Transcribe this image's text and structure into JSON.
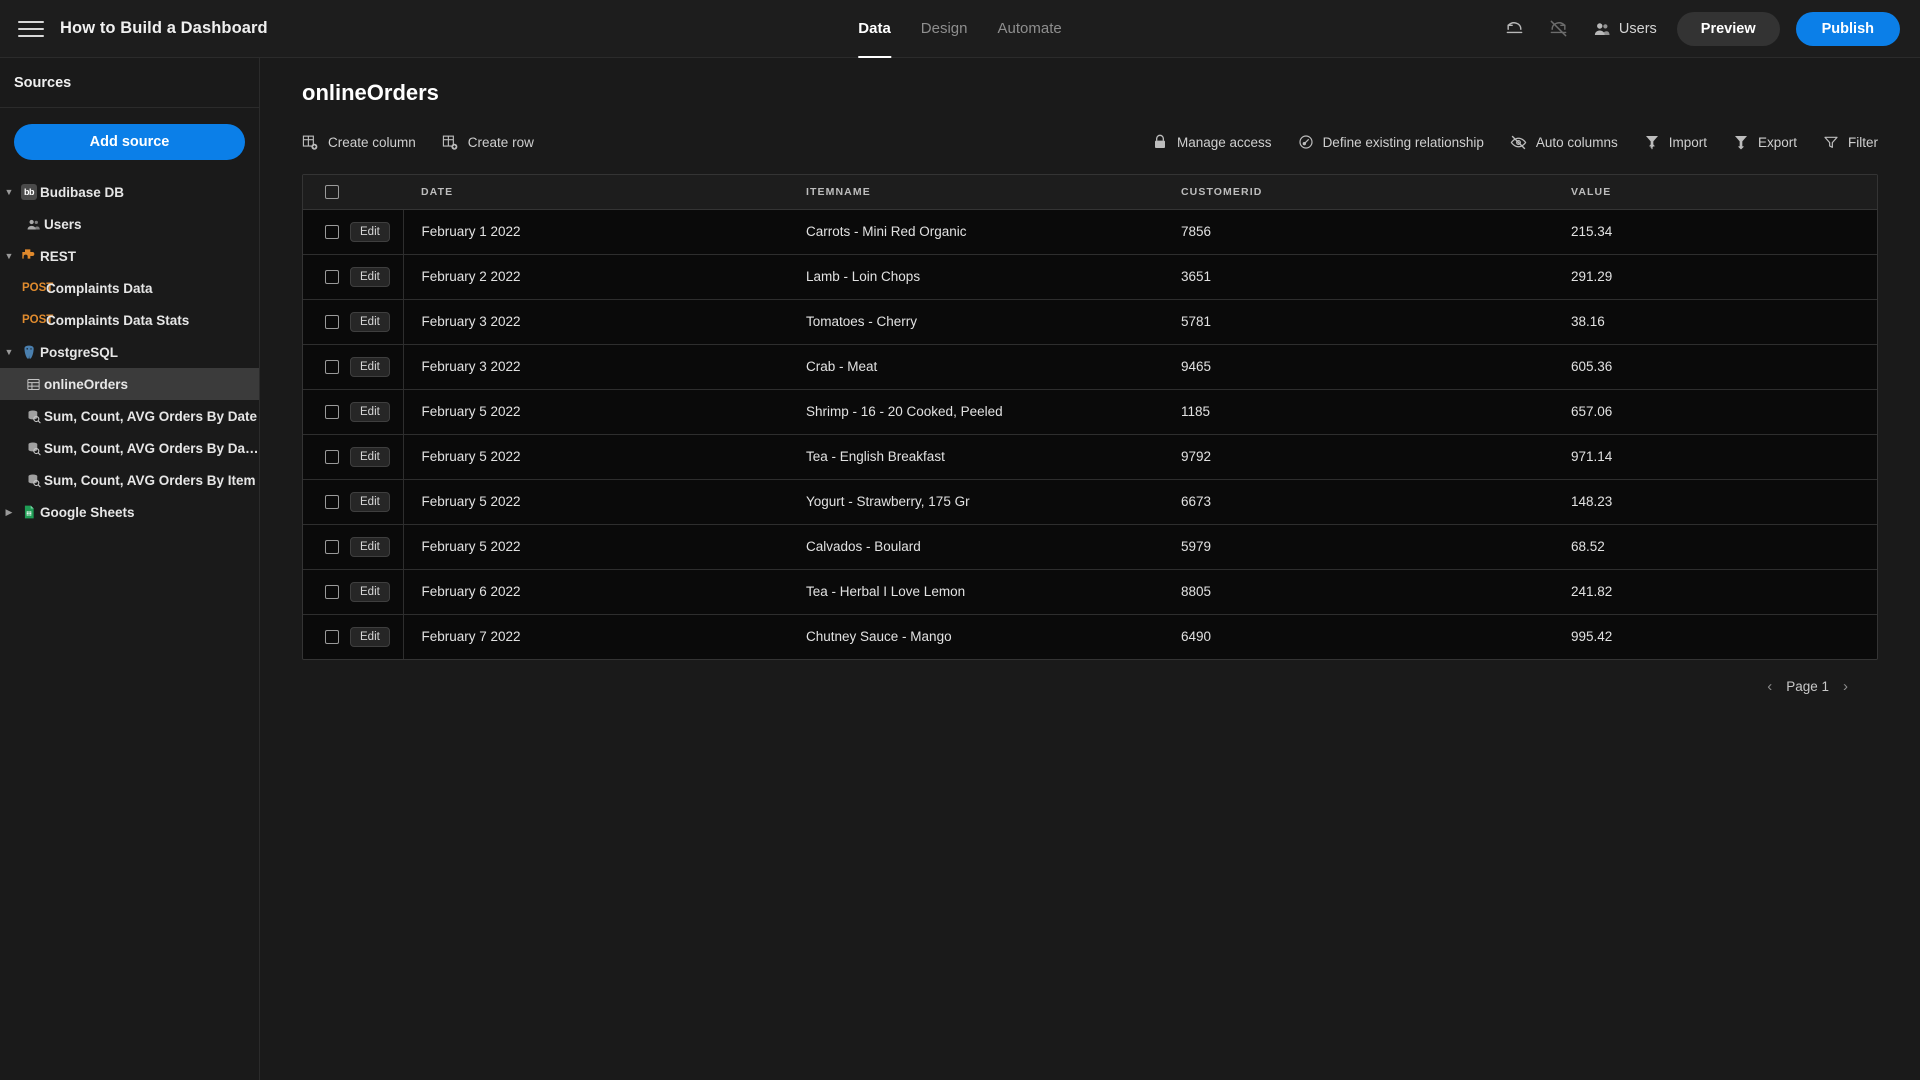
{
  "topbar": {
    "menu_icon": "hamburger-icon",
    "app_title": "How to Build a Dashboard",
    "tabs": [
      {
        "label": "Data",
        "active": true
      },
      {
        "label": "Design",
        "active": false
      },
      {
        "label": "Automate",
        "active": false
      }
    ],
    "undo_icon": "undo-icon",
    "redo_icon": "redo-disabled-icon",
    "users_icon": "users-icon",
    "users_label": "Users",
    "preview_label": "Preview",
    "publish_label": "Publish",
    "publish_color": "#0b7fe8"
  },
  "sidebar": {
    "header": "Sources",
    "add_source_label": "Add source",
    "tree": [
      {
        "level": 1,
        "icon": "budibase-db-icon",
        "label": "Budibase DB",
        "chevron": "down",
        "selected": false
      },
      {
        "level": 2,
        "icon": "users-icon",
        "label": "Users",
        "chevron": "",
        "selected": false
      },
      {
        "level": 1,
        "icon": "rest-icon",
        "label": "REST",
        "chevron": "down",
        "selected": false
      },
      {
        "level": 2,
        "icon": "",
        "method": "POST",
        "label": "Complaints Data",
        "chevron": "",
        "selected": false
      },
      {
        "level": 2,
        "icon": "",
        "method": "POST",
        "label": "Complaints Data Stats",
        "chevron": "",
        "selected": false
      },
      {
        "level": 1,
        "icon": "postgresql-icon",
        "label": "PostgreSQL",
        "chevron": "down",
        "selected": false
      },
      {
        "level": 2,
        "icon": "table-icon",
        "label": "onlineOrders",
        "chevron": "",
        "selected": true
      },
      {
        "level": 2,
        "icon": "query-icon",
        "label": "Sum, Count, AVG Orders By Date",
        "chevron": "",
        "selected": false
      },
      {
        "level": 2,
        "icon": "query-icon",
        "label": "Sum, Count, AVG Orders By Dat…",
        "chevron": "",
        "selected": false
      },
      {
        "level": 2,
        "icon": "query-icon",
        "label": "Sum, Count, AVG Orders By Item",
        "chevron": "",
        "selected": false
      },
      {
        "level": 1,
        "icon": "google-sheets-icon",
        "label": "Google Sheets",
        "chevron": "right",
        "selected": false
      }
    ]
  },
  "main": {
    "page_title": "onlineOrders",
    "toolbar_left": [
      {
        "icon": "create-column-icon",
        "label": "Create column"
      },
      {
        "icon": "create-row-icon",
        "label": "Create row"
      }
    ],
    "toolbar_right": [
      {
        "icon": "lock-icon",
        "label": "Manage access"
      },
      {
        "icon": "relationship-icon",
        "label": "Define existing relationship"
      },
      {
        "icon": "auto-columns-icon",
        "label": "Auto columns"
      },
      {
        "icon": "import-icon",
        "label": "Import"
      },
      {
        "icon": "export-icon",
        "label": "Export"
      },
      {
        "icon": "filter-icon",
        "label": "Filter"
      }
    ],
    "table": {
      "select_all_checked": false,
      "edit_label": "Edit",
      "columns": [
        "DATE",
        "ITEMNAME",
        "CUSTOMERID",
        "VALUE"
      ],
      "rows": [
        {
          "date": "February 1 2022",
          "itemname": "Carrots - Mini Red Organic",
          "customerid": "7856",
          "value": "215.34"
        },
        {
          "date": "February 2 2022",
          "itemname": "Lamb - Loin Chops",
          "customerid": "3651",
          "value": "291.29"
        },
        {
          "date": "February 3 2022",
          "itemname": "Tomatoes - Cherry",
          "customerid": "5781",
          "value": "38.16"
        },
        {
          "date": "February 3 2022",
          "itemname": "Crab - Meat",
          "customerid": "9465",
          "value": "605.36"
        },
        {
          "date": "February 5 2022",
          "itemname": "Shrimp - 16 - 20 Cooked, Peeled",
          "customerid": "1185",
          "value": "657.06"
        },
        {
          "date": "February 5 2022",
          "itemname": "Tea - English Breakfast",
          "customerid": "9792",
          "value": "971.14"
        },
        {
          "date": "February 5 2022",
          "itemname": "Yogurt - Strawberry, 175 Gr",
          "customerid": "6673",
          "value": "148.23"
        },
        {
          "date": "February 5 2022",
          "itemname": "Calvados - Boulard",
          "customerid": "5979",
          "value": "68.52"
        },
        {
          "date": "February 6 2022",
          "itemname": "Tea - Herbal I Love Lemon",
          "customerid": "8805",
          "value": "241.82"
        },
        {
          "date": "February 7 2022",
          "itemname": "Chutney Sauce - Mango",
          "customerid": "6490",
          "value": "995.42"
        }
      ]
    },
    "pagination": {
      "prev_icon": "chevron-left-icon",
      "label": "Page 1",
      "next_icon": "chevron-right-icon"
    }
  }
}
